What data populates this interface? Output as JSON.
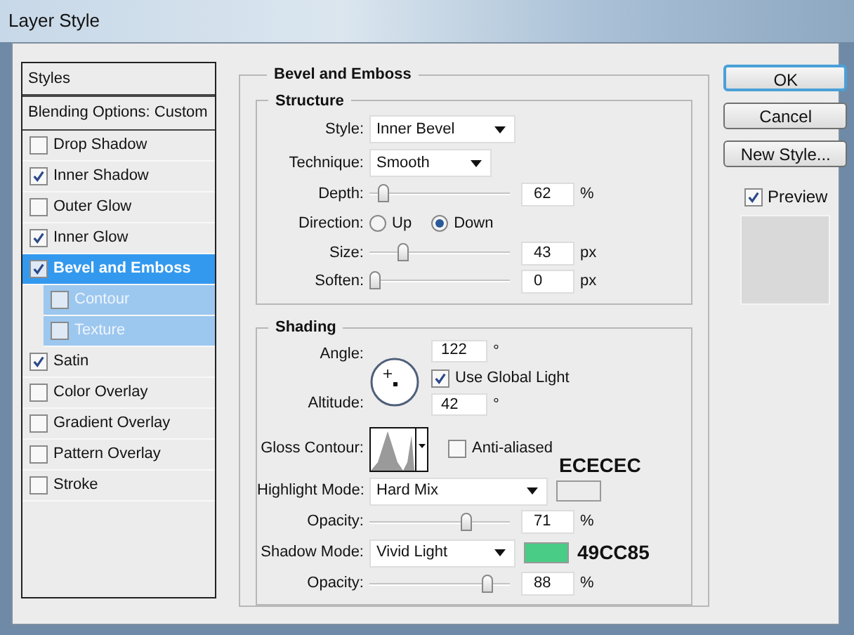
{
  "window": {
    "title": "Layer Style"
  },
  "styles_list": {
    "header": "Styles",
    "blending": "Blending Options: Custom",
    "items": [
      {
        "label": "Drop Shadow",
        "checked": false,
        "selected": false
      },
      {
        "label": "Inner Shadow",
        "checked": true,
        "selected": false
      },
      {
        "label": "Outer Glow",
        "checked": false,
        "selected": false
      },
      {
        "label": "Inner Glow",
        "checked": true,
        "selected": false
      },
      {
        "label": "Bevel and Emboss",
        "checked": true,
        "selected": true,
        "children": [
          {
            "label": "Contour",
            "checked": false,
            "selected": false
          },
          {
            "label": "Texture",
            "checked": false,
            "selected": false
          }
        ]
      },
      {
        "label": "Satin",
        "checked": true,
        "selected": false
      },
      {
        "label": "Color Overlay",
        "checked": false,
        "selected": false
      },
      {
        "label": "Gradient Overlay",
        "checked": false,
        "selected": false
      },
      {
        "label": "Pattern Overlay",
        "checked": false,
        "selected": false
      },
      {
        "label": "Stroke",
        "checked": false,
        "selected": false
      }
    ]
  },
  "panel": {
    "title": "Bevel and Emboss",
    "structure": {
      "title": "Structure",
      "rows": [
        {
          "kind": "select",
          "label": "Style:",
          "value": "Inner Bevel"
        },
        {
          "kind": "select",
          "label": "Technique:",
          "value": "Smooth"
        },
        {
          "kind": "slider",
          "label": "Depth:",
          "level": 0.06,
          "value": "62",
          "unit": "%"
        },
        {
          "kind": "radio",
          "label": "Direction:",
          "options": [
            {
              "label": "Up",
              "selected": false
            },
            {
              "label": "Down",
              "selected": true
            }
          ]
        },
        {
          "kind": "slider",
          "label": "Size:",
          "level": 0.22,
          "value": "43",
          "unit": "px"
        },
        {
          "kind": "slider",
          "label": "Soften:",
          "level": 0.0,
          "value": "0",
          "unit": "px"
        }
      ]
    },
    "shading": {
      "title": "Shading",
      "angle": {
        "label": "Angle:",
        "value": "122",
        "unit": "°"
      },
      "use_global_light": {
        "label": "Use Global Light",
        "checked": true
      },
      "altitude": {
        "label": "Altitude:",
        "value": "42",
        "unit": "°"
      },
      "gloss_contour": {
        "label": "Gloss Contour:"
      },
      "anti_aliased": {
        "label": "Anti-aliased",
        "checked": false
      },
      "rows": [
        {
          "kind": "select",
          "label": "Highlight Mode:",
          "value": "Hard Mix",
          "color": "#ececec",
          "annotation": "ECECEC"
        },
        {
          "kind": "slider",
          "label": "Opacity:",
          "level": 0.71,
          "value": "71",
          "unit": "%"
        },
        {
          "kind": "select",
          "label": "Shadow Mode:",
          "value": "Vivid Light",
          "color": "#49cc85",
          "annotation": "49CC85"
        },
        {
          "kind": "slider",
          "label": "Opacity:",
          "level": 0.87,
          "value": "88",
          "unit": "%"
        }
      ]
    }
  },
  "buttons": [
    {
      "label": "OK",
      "default": true
    },
    {
      "label": "Cancel",
      "default": false
    },
    {
      "label": "New Style...",
      "default": false
    }
  ],
  "preview": {
    "label": "Preview",
    "checked": true
  }
}
